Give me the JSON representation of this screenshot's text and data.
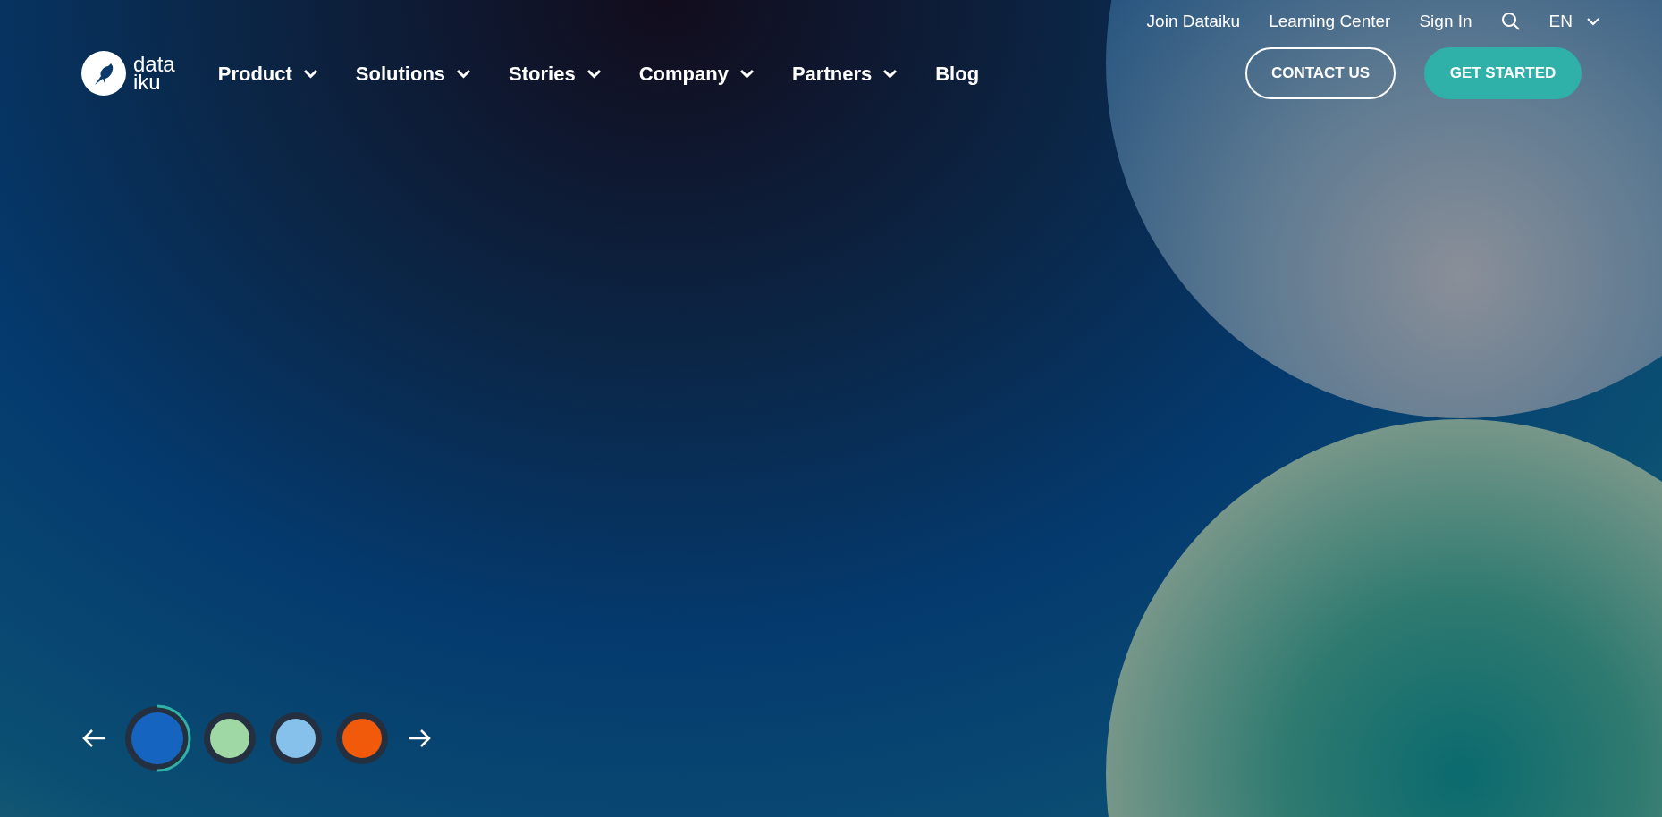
{
  "top_links": [
    {
      "label": "Join Dataiku"
    },
    {
      "label": "Learning Center"
    },
    {
      "label": "Sign In"
    }
  ],
  "language": {
    "label": "EN"
  },
  "logo": {
    "line_1": "data",
    "line_2": "iku"
  },
  "nav": [
    {
      "label": "Product",
      "has_menu": true
    },
    {
      "label": "Solutions",
      "has_menu": true
    },
    {
      "label": "Stories",
      "has_menu": true
    },
    {
      "label": "Company",
      "has_menu": true
    },
    {
      "label": "Partners",
      "has_menu": true
    },
    {
      "label": "Blog",
      "has_menu": false
    }
  ],
  "buttons": [
    {
      "label": "CONTACT US",
      "kind": "outline"
    },
    {
      "label": "GET STARTED",
      "kind": "filled"
    }
  ],
  "carousel": {
    "slides": [
      {
        "selected": true,
        "level": 0.5,
        "color": "#1565c0"
      },
      {
        "selected": false,
        "color": "#9fd8a4"
      },
      {
        "selected": false,
        "color": "#85c1ea"
      },
      {
        "selected": false,
        "color": "#f15a0a"
      }
    ]
  }
}
